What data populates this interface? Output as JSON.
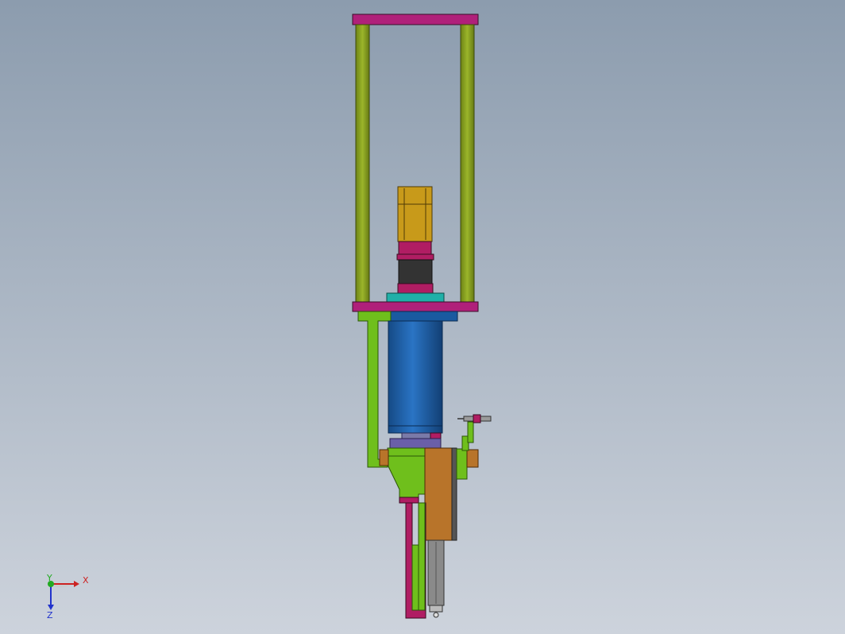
{
  "viewport": {
    "background_top": "#8c9cae",
    "background_bottom": "#cdd3dc"
  },
  "triad": {
    "x_label": "X",
    "y_label": "Y",
    "z_label": "Z",
    "x_color": "#cc2222",
    "y_color": "#22aa22",
    "z_color": "#2233cc"
  },
  "colors": {
    "frame_plate": "#b0207a",
    "guide_rod": "#8aa020",
    "motor_body": "#c89a1a",
    "coupling_magenta": "#b01d63",
    "coupling_dark": "#333333",
    "cyan_plate": "#20b0a8",
    "cylinder_blue": "#1f63b0",
    "bracket_green": "#6fbf1c",
    "orange_block": "#b8742a",
    "rod_gray": "#8a8a8a",
    "lavender_plate": "#6a5fa8"
  }
}
